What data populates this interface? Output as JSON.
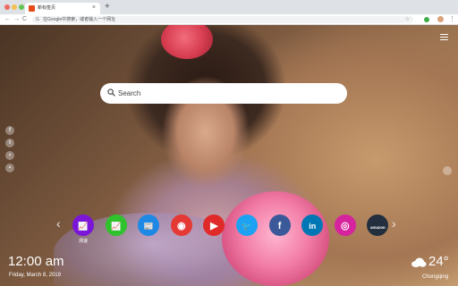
{
  "browser": {
    "tab_title": "新标签页",
    "tab_close": "×",
    "new_tab": "+",
    "address": "在Google中搜索，或者输入一个网址",
    "back": "←",
    "forward": "→",
    "reload": "C",
    "menu": "⋮"
  },
  "search": {
    "placeholder": "Search"
  },
  "side_icons": [
    {
      "name": "facebook-icon",
      "glyph": "f"
    },
    {
      "name": "twitter-icon",
      "glyph": "t"
    },
    {
      "name": "bell-icon",
      "glyph": "•"
    },
    {
      "name": "settings-icon",
      "glyph": "•"
    }
  ],
  "shortcuts": [
    {
      "name": "analytics",
      "icon": "chart-line-icon",
      "glyph": "📈",
      "color": "#7b16d9",
      "label": "测速"
    },
    {
      "name": "stocks",
      "icon": "stock-chart-icon",
      "glyph": "📈",
      "color": "#2fc22c",
      "label": ""
    },
    {
      "name": "news",
      "icon": "newspaper-icon",
      "glyph": "📰",
      "color": "#1e88e5",
      "label": ""
    },
    {
      "name": "weibo",
      "icon": "weibo-icon",
      "glyph": "◉",
      "color": "#e53935",
      "label": ""
    },
    {
      "name": "youtube",
      "icon": "youtube-icon",
      "glyph": "▶",
      "color": "#e02a2a",
      "label": ""
    },
    {
      "name": "twitter",
      "icon": "twitter-bird-icon",
      "glyph": "🐦",
      "color": "#1da1f2",
      "label": ""
    },
    {
      "name": "facebook",
      "icon": "facebook-icon",
      "glyph": "f",
      "color": "#3b5998",
      "label": ""
    },
    {
      "name": "linkedin",
      "icon": "linkedin-icon",
      "glyph": "in",
      "color": "#0077b5",
      "label": ""
    },
    {
      "name": "instagram",
      "icon": "instagram-icon",
      "glyph": "◎",
      "color": "#d6249f",
      "label": ""
    },
    {
      "name": "amazon",
      "icon": "amazon-icon",
      "glyph": "amazon",
      "color": "#232f3e",
      "label": ""
    }
  ],
  "nav_arrows": {
    "left": "‹",
    "right": "›"
  },
  "clock": {
    "time": "12:00 am",
    "date": "Friday, March 8, 2019"
  },
  "weather": {
    "temp": "24°",
    "city": "Chongqing"
  }
}
